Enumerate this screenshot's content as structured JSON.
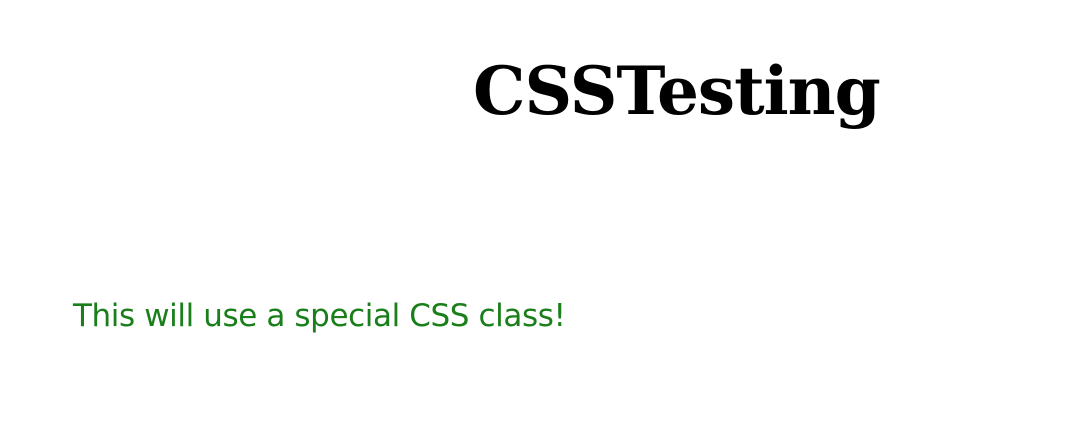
{
  "page": {
    "title": "CSSTesting",
    "special_text": "This will use a special CSS class!"
  },
  "colors": {
    "background": "#ffffff",
    "title": "#000000",
    "special_text": "#1a7f1a"
  }
}
